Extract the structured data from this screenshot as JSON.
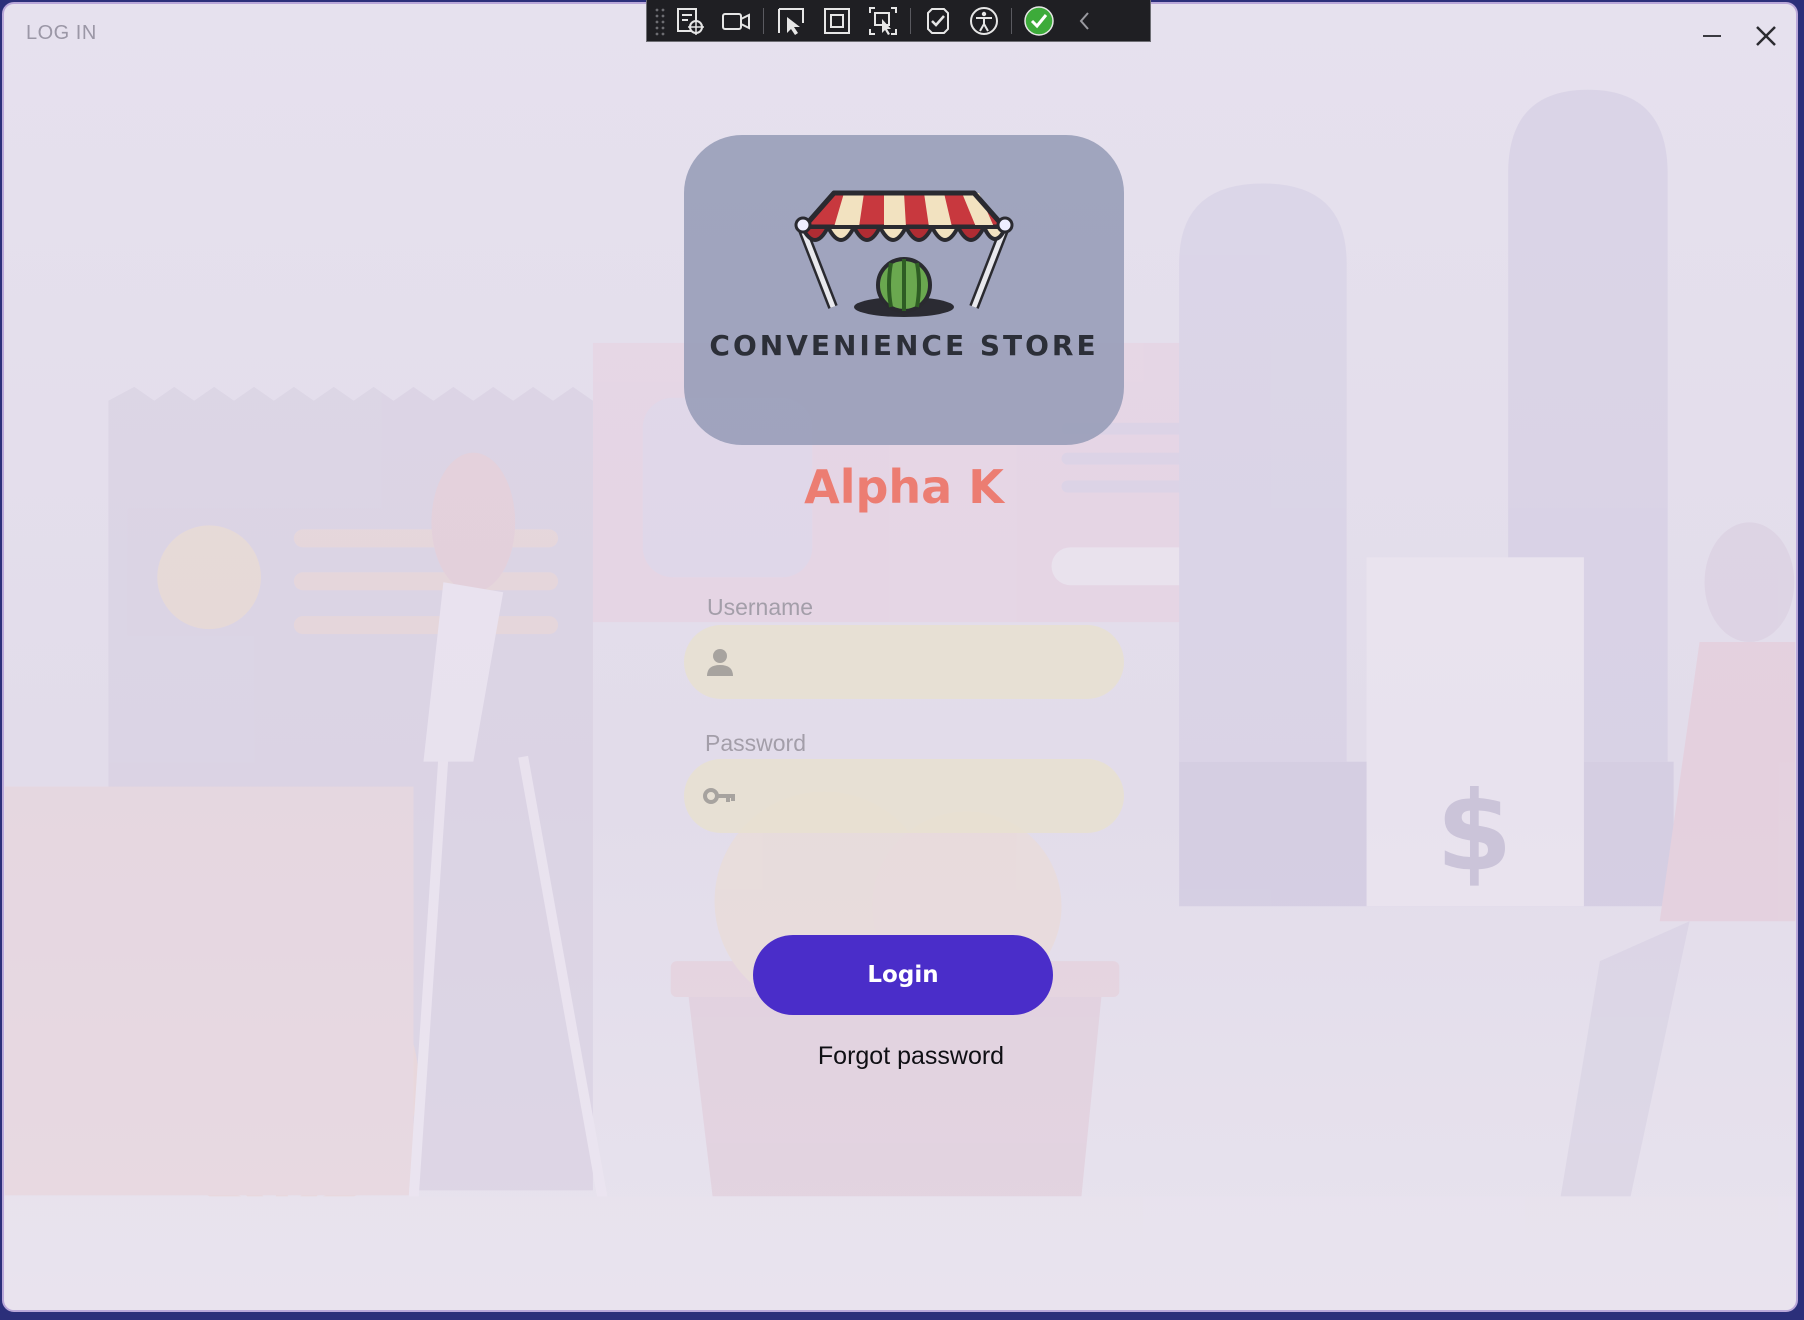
{
  "window": {
    "title": "LOG IN",
    "minimize_icon": "minimize-icon",
    "close_icon": "close-icon"
  },
  "dev_toolbar": {
    "items": [
      "select-element-icon",
      "video-camera-icon",
      "cursor-select-icon",
      "square-frame-icon",
      "track-focus-icon",
      "hot-reload-icon",
      "accessibility-icon",
      "checkmark-circle-icon",
      "collapse-chevron-icon"
    ]
  },
  "logo": {
    "brand_text": "CONVENIENCE STORE",
    "icon": "storefront-awning-icon"
  },
  "app_name": "Alpha K",
  "form": {
    "username_label": "Username",
    "username_value": "",
    "username_icon": "user-icon",
    "password_label": "Password",
    "password_value": "",
    "password_icon": "key-icon",
    "login_label": "Login",
    "forgot_label": "Forgot password"
  },
  "colors": {
    "accent": "#4a2dc9",
    "app_name": "#ec7d72",
    "field_bg": "#e8e0d0"
  }
}
